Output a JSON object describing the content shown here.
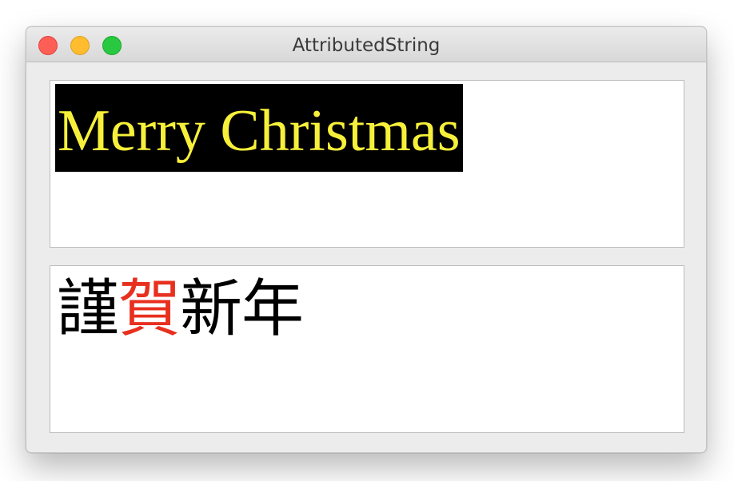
{
  "window": {
    "title": "AttributedString"
  },
  "text_view_1": {
    "text": "Merry Christmas",
    "foreground_color": "#f7f03a",
    "background_color": "#000000"
  },
  "text_view_2": {
    "segments": [
      {
        "text": "謹",
        "color": "#000000"
      },
      {
        "text": "賀",
        "color": "#e8301f"
      },
      {
        "text": "新年",
        "color": "#000000"
      }
    ]
  }
}
